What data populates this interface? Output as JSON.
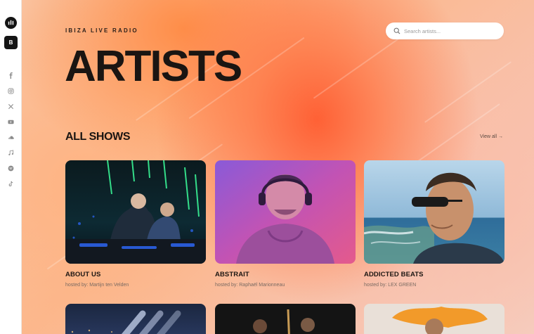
{
  "sidebar": {
    "logo_icon": "radio-bars-logo",
    "menu_button_label": "B",
    "social_icons": [
      "facebook-icon",
      "instagram-icon",
      "x-icon",
      "youtube-icon",
      "soundcloud-icon",
      "music-note-icon",
      "spotify-icon",
      "tiktok-icon"
    ]
  },
  "header": {
    "brand": "IBIZA LIVE RADIO",
    "search_placeholder": "Search artists..."
  },
  "hero": {
    "title": "ARTISTS"
  },
  "section": {
    "title": "ALL SHOWS",
    "view_all": "View all →"
  },
  "cards": [
    {
      "title": "ABOUT US",
      "host": "hosted by: Martijn ten Velden"
    },
    {
      "title": "ABSTRAIT",
      "host": "hosted by: Raphaël Marionneau"
    },
    {
      "title": "ADDICTED BEATS",
      "host": "hosted by: LEX GREEN"
    }
  ],
  "colors": {
    "accent_orange": "#ff6a3d",
    "text_dark": "#1a1512",
    "sidebar_bg": "#ffffff"
  }
}
